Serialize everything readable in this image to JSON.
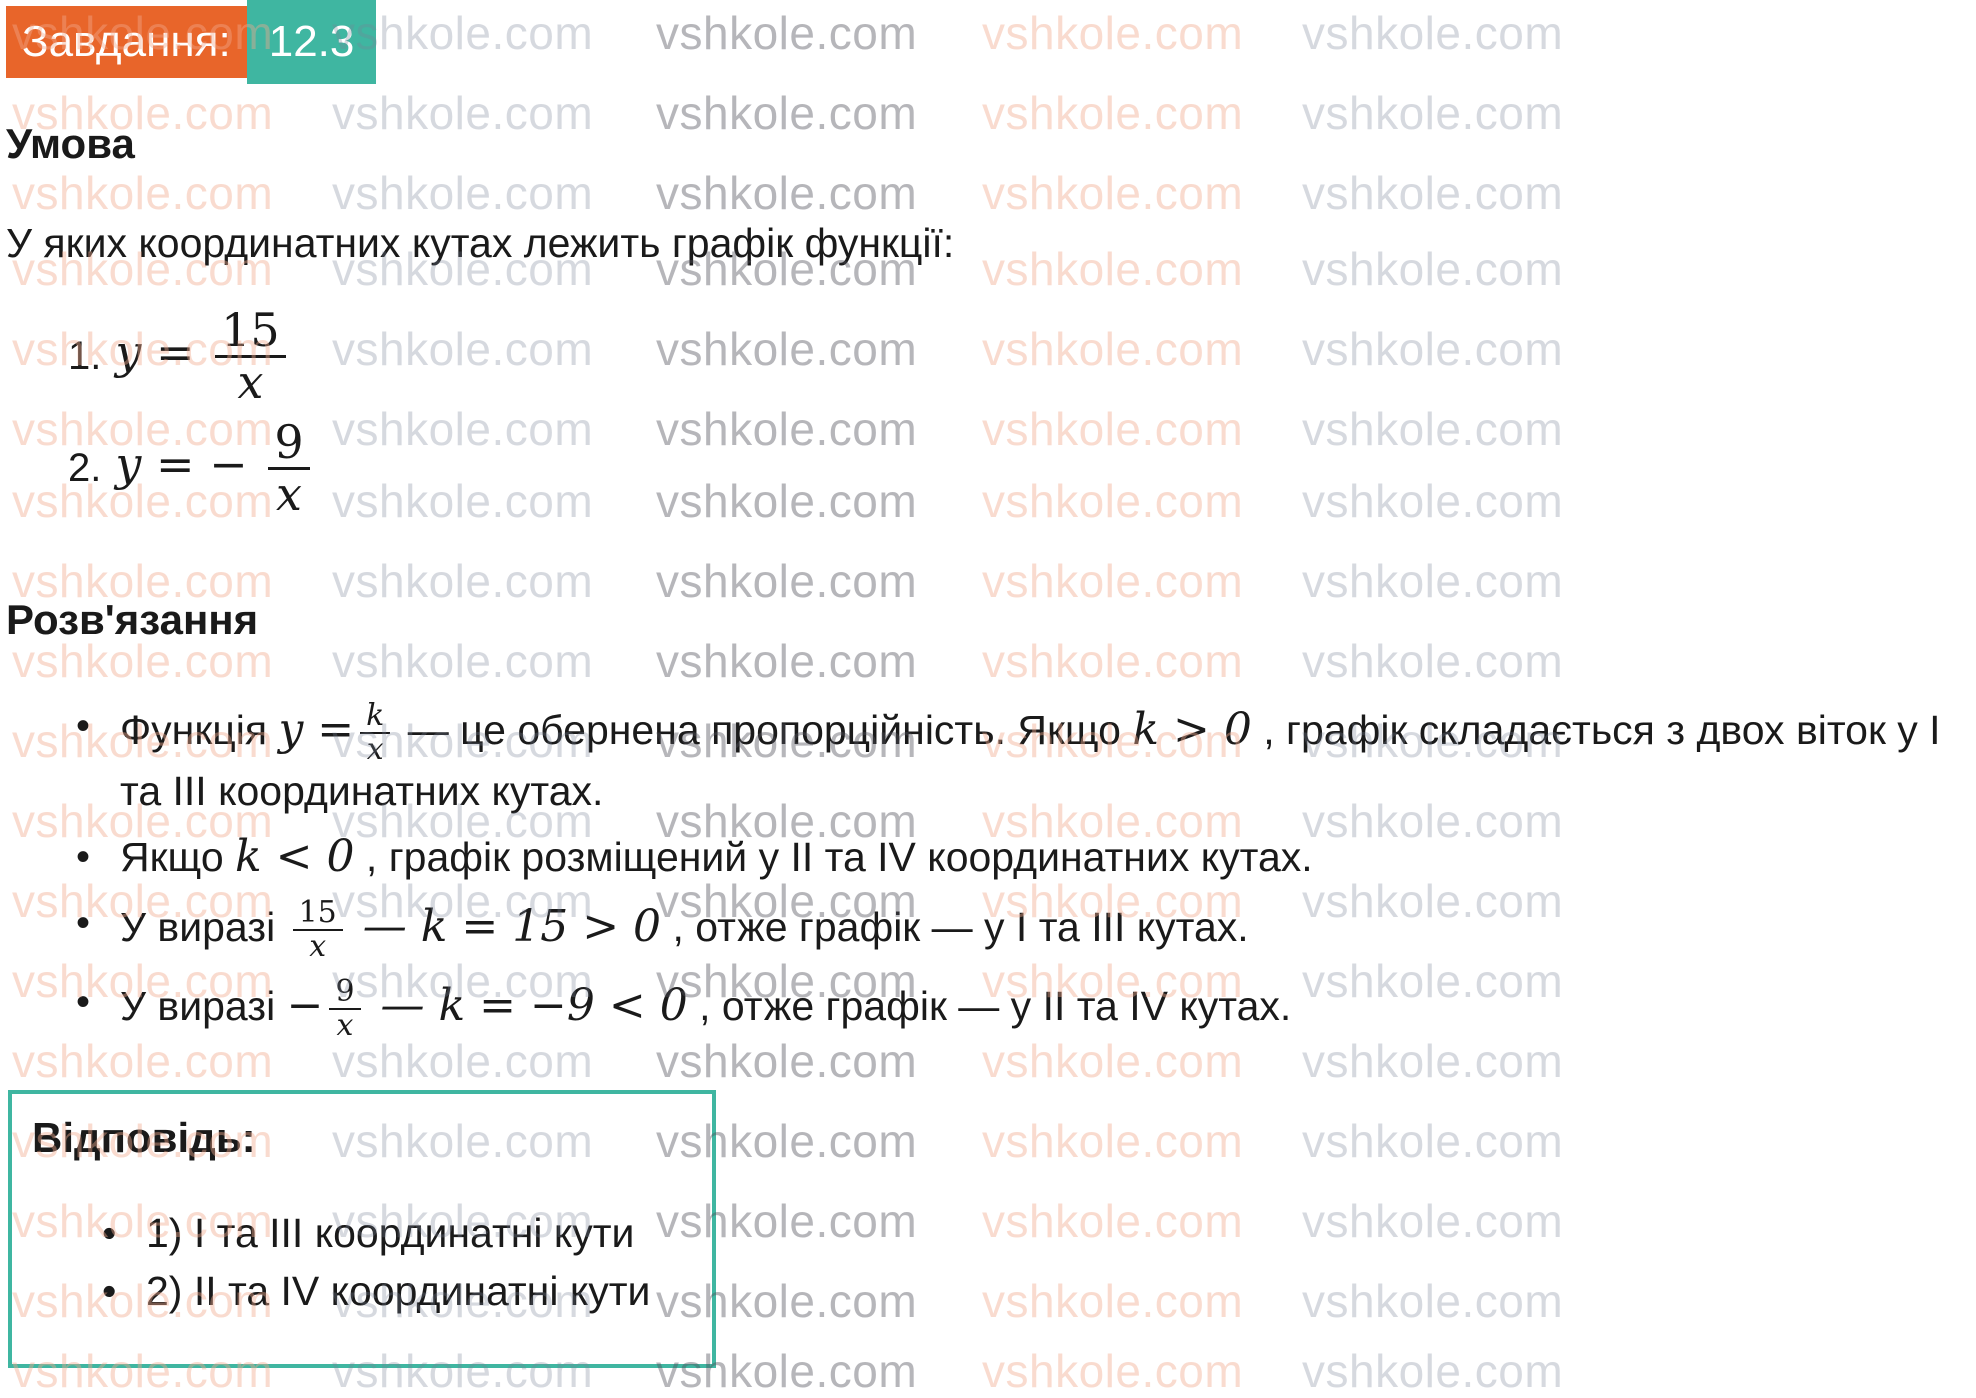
{
  "badge": {
    "label": "Завдання:",
    "number": "12.3"
  },
  "condition": {
    "title": "Умова",
    "question": "У яких координатних кутах лежить графік функції:",
    "items": [
      {
        "num": "1.",
        "lhs": "y =",
        "sign": "",
        "numerator": "15",
        "denominator": "x"
      },
      {
        "num": "2.",
        "lhs": "y =",
        "sign": "−",
        "numerator": "9",
        "denominator": "x"
      }
    ]
  },
  "solution": {
    "title": "Розв'язання",
    "bullets": [
      {
        "t1": "Функція ",
        "m1": "y =",
        "fn": "k",
        "fd": "x",
        "t2": " — це обернена пропорційність. Якщо ",
        "m2": "k > 0",
        "t3": ", графік складається з двох віток у I та III координатних кутах."
      },
      {
        "t1": "Якщо ",
        "m1": "k < 0",
        "t2": ", графік розміщений у II та IV координатних кутах."
      },
      {
        "t1": "У виразі ",
        "sign": "",
        "fn": "15",
        "fd": "x",
        "m1": " — k = 15 > 0",
        "t2": ", отже графік — у I та III кутах."
      },
      {
        "t1": "У виразі ",
        "sign": "−",
        "fn": "9",
        "fd": "x",
        "m1": " — k = −9 < 0",
        "t2": ", отже графік — у II та IV кутах."
      }
    ]
  },
  "answer": {
    "title": "Відповідь:",
    "items": [
      "1) I та III координатні кути",
      "2) II та IV координатні кути"
    ]
  },
  "watermark": {
    "text": "vshkole.com"
  },
  "colors": {
    "badge_label_bg": "#e8652a",
    "badge_number_bg": "#3fb6a1",
    "answer_border": "#3fb6a1"
  }
}
